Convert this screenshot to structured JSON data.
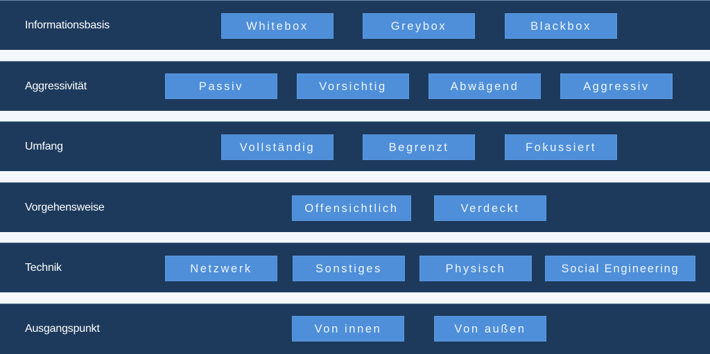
{
  "colors": {
    "row_background": "#1d3a5c",
    "button_background": "#4f8fd9",
    "gap_background": "#f4f8fc",
    "text": "#ffffff"
  },
  "rows": [
    {
      "label": "Informationsbasis",
      "options": [
        "Whitebox",
        "Greybox",
        "Blackbox"
      ]
    },
    {
      "label": "Aggressivität",
      "options": [
        "Passiv",
        "Vorsichtig",
        "Abwägend",
        "Aggressiv"
      ]
    },
    {
      "label": "Umfang",
      "options": [
        "Vollständig",
        "Begrenzt",
        "Fokussiert"
      ]
    },
    {
      "label": "Vorgehensweise",
      "options": [
        "Offensichtlich",
        "Verdeckt"
      ]
    },
    {
      "label": "Technik",
      "options": [
        "Netzwerk",
        "Sonstiges",
        "Physisch",
        "Social Engineering"
      ]
    },
    {
      "label": "Ausgangspunkt",
      "options": [
        "Von innen",
        "Von außen"
      ]
    }
  ]
}
